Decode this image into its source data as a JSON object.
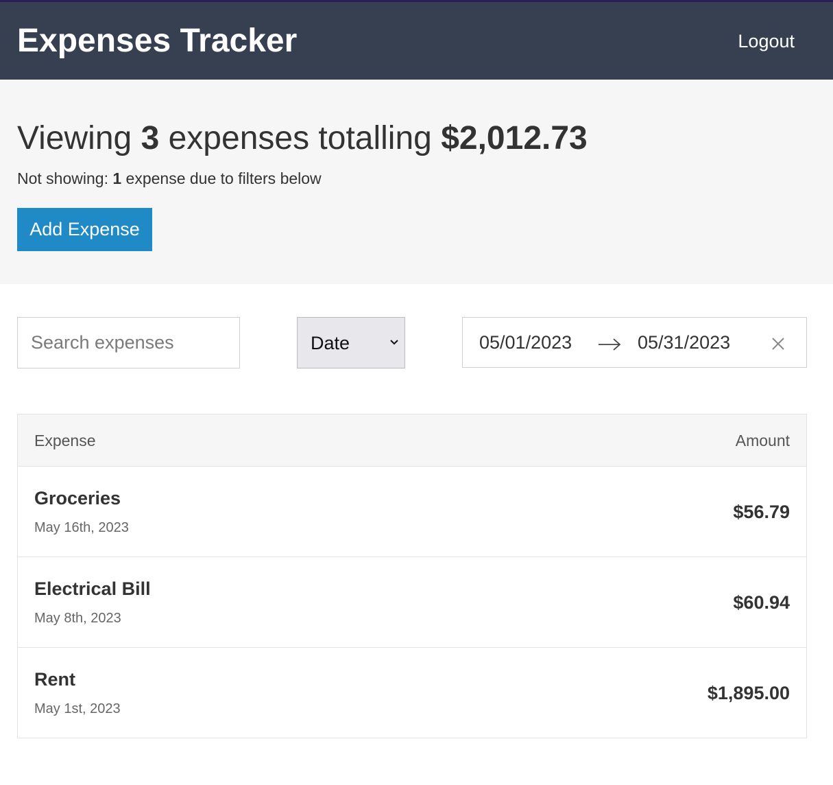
{
  "header": {
    "title": "Expenses Tracker",
    "logout_label": "Logout"
  },
  "summary": {
    "prefix": "Viewing ",
    "count": "3",
    "middle": " expenses totalling ",
    "total": "$2,012.73",
    "sub_prefix": "Not showing: ",
    "hidden_count": "1",
    "sub_suffix": " expense due to filters below",
    "add_button_label": "Add Expense"
  },
  "filters": {
    "search_placeholder": "Search expenses",
    "search_value": "",
    "sort_selected": "Date",
    "date_start": "05/01/2023",
    "date_end": "05/31/2023",
    "icons": {
      "sort": "chevron-down-icon",
      "range": "arrow-right-icon",
      "clear": "close-icon"
    }
  },
  "table": {
    "columns": [
      "Expense",
      "Amount"
    ],
    "rows": [
      {
        "name": "Groceries",
        "date": "May 16th, 2023",
        "amount": "$56.79"
      },
      {
        "name": "Electrical Bill",
        "date": "May 8th, 2023",
        "amount": "$60.94"
      },
      {
        "name": "Rent",
        "date": "May 1st, 2023",
        "amount": "$1,895.00"
      }
    ]
  },
  "colors": {
    "header_bg": "#364051",
    "summary_bg": "#f6f6f6",
    "accent": "#1f8ac6",
    "text": "#333333"
  }
}
